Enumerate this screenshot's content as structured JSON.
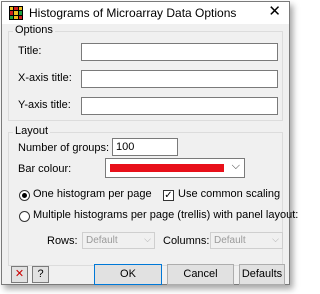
{
  "window": {
    "title": "Histograms of Microarray Data Options",
    "close_glyph": "✕"
  },
  "options": {
    "group_label": "Options",
    "title_label": "Title:",
    "title_value": "",
    "xaxis_label": "X-axis title:",
    "xaxis_value": "",
    "yaxis_label": "Y-axis title:",
    "yaxis_value": ""
  },
  "layout": {
    "group_label": "Layout",
    "groups_label": "Number of groups:",
    "groups_value": "100",
    "bar_colour_label": "Bar colour:",
    "bar_colour": "#e8101a",
    "one_per_page_label": "One histogram per page",
    "one_per_page_selected": true,
    "common_scaling_label": "Use common scaling",
    "common_scaling_checked": true,
    "multi_per_page_label": "Multiple histograms per page (trellis) with panel layout:",
    "multi_per_page_selected": false,
    "rows_label": "Rows:",
    "rows_value": "Default",
    "columns_label": "Columns:",
    "columns_value": "Default"
  },
  "buttons": {
    "close_icon_glyph": "✕",
    "help_icon_glyph": "?",
    "ok": "OK",
    "cancel": "Cancel",
    "defaults": "Defaults"
  }
}
